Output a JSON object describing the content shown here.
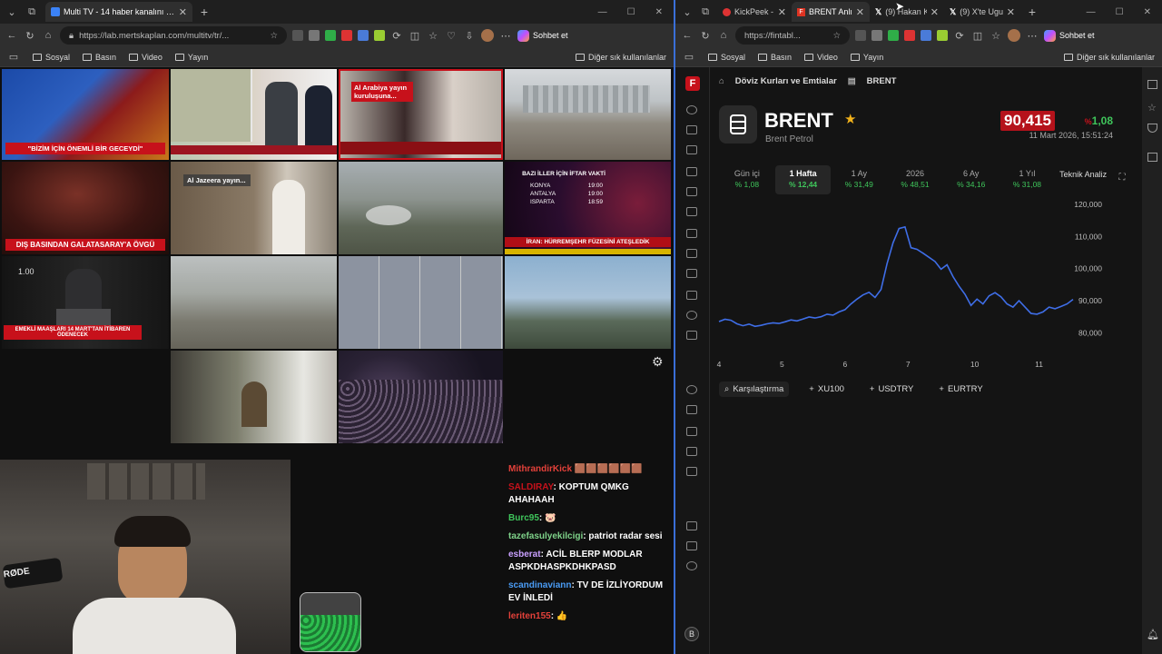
{
  "left_window": {
    "tabs": [
      {
        "label": "Multi TV - 14 haber kanalını aynı a",
        "active": true
      }
    ],
    "url": "https://lab.mertskaplan.com/multitv/tr/...",
    "chat_button": "Sohbet et",
    "bookmarks": [
      "Sosyal",
      "Basın",
      "Video",
      "Yayın"
    ],
    "other_bookmarks": "Diğer sık kullanılanlar",
    "tiles": {
      "t1_caption": "\"BİZİM İÇİN ÖNEMLİ BİR GECEYDİ\"",
      "t3_caption": "Al Arabiya yayın kuruluşuna...",
      "t5_caption": "DIŞ BASINDAN GALATASARAY'A ÖVGÜ",
      "t6_caption": "Al Jazeera yayın...",
      "t8_iftar_title": "BAZI İLLER İÇİN İFTAR VAKTİ",
      "t8_rows": [
        [
          "KONYA",
          "19:00"
        ],
        [
          "ANTALYA",
          "19:00"
        ],
        [
          "ISPARTA",
          "18:59"
        ]
      ],
      "t8_caption": "İRAN: HÜRREMŞEHR FÜZESİNİ ATEŞLEDİK",
      "t9_caption": "EMEKLİ MAAŞLARI 14 MART'TAN İTİBAREN ÖDENECEK",
      "t9_overlay": "1.00"
    },
    "chat": [
      {
        "user": "MithrandirKick",
        "text": "🟫🟫🟫🟫🟫🟫",
        "color": "#e4413a"
      },
      {
        "user": "SALDIRAY",
        "text": "KOPTUM QMKG AHAHAAH",
        "color": "#c7111b"
      },
      {
        "user": "Burc95",
        "text": "🐷",
        "color": "#3fc55b"
      },
      {
        "user": "tazefasulyekilcigi",
        "text": "patriot radar sesi",
        "color": "#7fd38a"
      },
      {
        "user": "esberat",
        "text": "ACİL BLERP MODLAR ASPKDHASPKDHKPASD",
        "color": "#c9a0ff"
      },
      {
        "user": "scandinaviann",
        "text": "TV DE İZLİYORDUM EV İNLEDİ",
        "color": "#4a9cf5"
      },
      {
        "user": "leriten155",
        "text": "👍",
        "color": "#e4413a"
      }
    ],
    "cam_brand": "RØDE"
  },
  "right_window": {
    "tabs": [
      {
        "label": "KickPeek - Re",
        "active": false
      },
      {
        "label": "BRENT Anlık",
        "active": true
      },
      {
        "label": "(9) Hakan Kil",
        "active": false
      },
      {
        "label": "(9) X'te Ugur",
        "active": false
      }
    ],
    "url": "https://fintabl...",
    "chat_button": "Sohbet et",
    "bookmarks": [
      "Sosyal",
      "Basın",
      "Video",
      "Yayın"
    ],
    "other_bookmarks": "Diğer sık kullanılanlar",
    "breadcrumb": [
      "Döviz Kurları ve Emtialar",
      "BRENT"
    ],
    "title": "BRENT",
    "subtitle": "Brent Petrol",
    "price": "90,415",
    "change_pct_symbol": "%",
    "change": "1,08",
    "timestamp": "11 Mart 2026, 15:51:24",
    "periods": [
      {
        "label": "Gün içi",
        "value": "% 1,08",
        "active": false
      },
      {
        "label": "1 Hafta",
        "value": "% 12,44",
        "active": true
      },
      {
        "label": "1 Ay",
        "value": "% 31,49",
        "active": false
      },
      {
        "label": "2026",
        "value": "% 48,51",
        "active": false
      },
      {
        "label": "6 Ay",
        "value": "% 34,16",
        "active": false
      },
      {
        "label": "1 Yıl",
        "value": "% 31,08",
        "active": false
      },
      {
        "label": "Teknik Analiz",
        "value": "",
        "active": false
      }
    ],
    "compare": [
      "Karşılaştırma",
      "XU100",
      "USDTRY",
      "EURTRY"
    ],
    "avatar_letter": "B"
  },
  "chart_data": {
    "type": "line",
    "title": "",
    "xlabel": "",
    "ylabel": "",
    "x_ticks": [
      "4",
      "5",
      "6",
      "7",
      "10",
      "11"
    ],
    "y_ticks": [
      "120,000",
      "110,000",
      "100,000",
      "90,000",
      "80,000"
    ],
    "ylim": [
      75000,
      122000
    ],
    "series": [
      {
        "values": [
          83500,
          84200,
          83900,
          82800,
          82200,
          82700,
          82000,
          82300,
          82800,
          83100,
          82900,
          83400,
          84000,
          83700,
          84300,
          84900,
          84600,
          85000,
          85800,
          85500,
          86500,
          87200,
          89000,
          90500,
          91800,
          92600,
          91000,
          93500,
          101500,
          108000,
          112500,
          113000,
          106500,
          106000,
          104800,
          103500,
          102200,
          99800,
          101200,
          97500,
          94500,
          92000,
          88500,
          90500,
          89000,
          91500,
          92500,
          91200,
          89000,
          88000,
          90000,
          88000,
          86000,
          85800,
          86500,
          88000,
          87500,
          88200,
          89000,
          90415
        ],
        "color": "#3f6ee8"
      }
    ]
  }
}
